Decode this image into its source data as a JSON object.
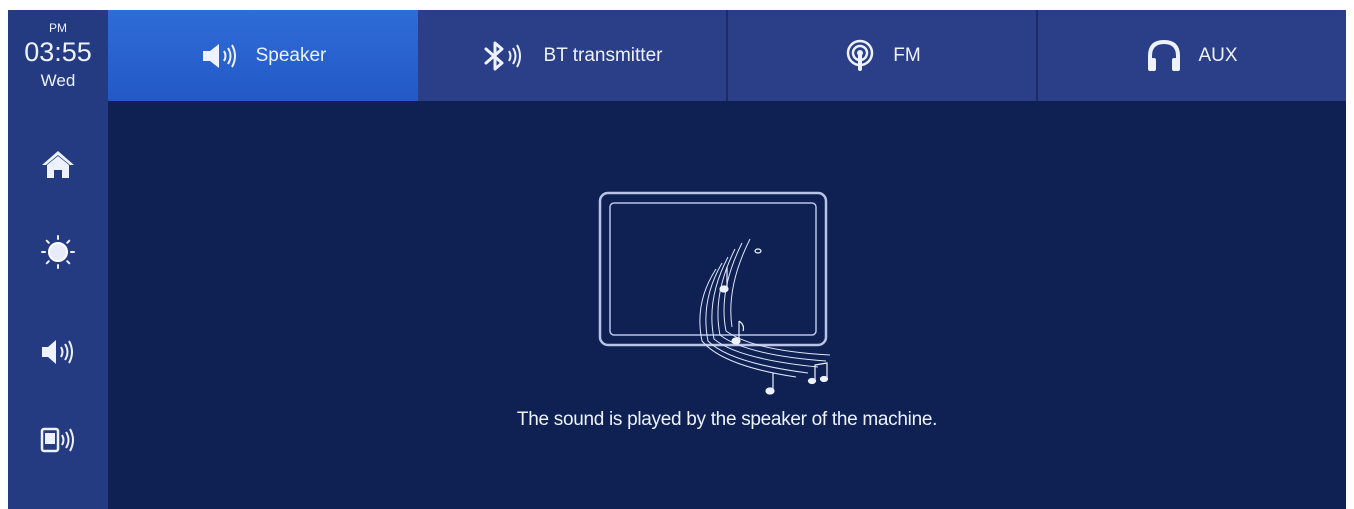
{
  "clock": {
    "ampm": "PM",
    "time": "03:55",
    "day": "Wed"
  },
  "sidebar": {
    "items": [
      {
        "name": "home",
        "icon": "home-icon"
      },
      {
        "name": "brightness",
        "icon": "sun-icon"
      },
      {
        "name": "volume",
        "icon": "speaker-icon"
      },
      {
        "name": "device-audio",
        "icon": "phone-audio-icon"
      }
    ]
  },
  "tabs": [
    {
      "label": "Speaker",
      "icon": "speaker-icon",
      "active": true
    },
    {
      "label": "BT transmitter",
      "icon": "bluetooth-icon",
      "active": false
    },
    {
      "label": "FM",
      "icon": "radio-icon",
      "active": false
    },
    {
      "label": "AUX",
      "icon": "headphones-icon",
      "active": false
    }
  ],
  "main": {
    "message": "The sound is played by the speaker of the machine."
  },
  "colors": {
    "background": "#0e2152",
    "sidebar": "#243b82",
    "tab": "#2a3f88",
    "tab_active": "#2f6cd8",
    "text": "#eef2ff"
  }
}
